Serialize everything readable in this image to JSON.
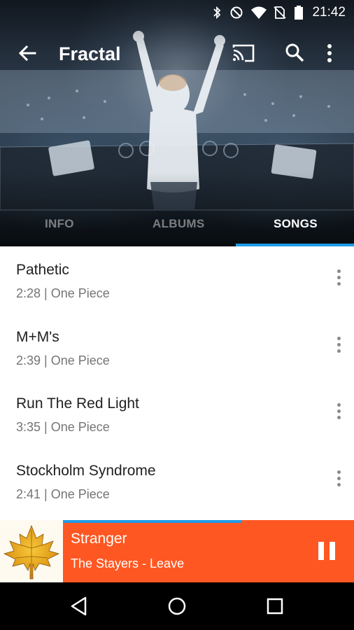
{
  "status_bar": {
    "time": "21:42",
    "icons": [
      "bluetooth-icon",
      "do-not-disturb-icon",
      "wifi-icon",
      "no-sim-icon",
      "battery-icon"
    ]
  },
  "toolbar": {
    "title": "Fractal",
    "icons": [
      "back-arrow-icon",
      "cast-icon",
      "search-icon",
      "more-vert-icon"
    ]
  },
  "tabs": [
    {
      "label": "INFO",
      "selected": false
    },
    {
      "label": "ALBUMS",
      "selected": false
    },
    {
      "label": "SONGS",
      "selected": true
    }
  ],
  "songs": [
    {
      "title": "Pathetic",
      "subtitle": "2:28 | One Piece"
    },
    {
      "title": "M+M's",
      "subtitle": "2:39 | One Piece"
    },
    {
      "title": "Run The Red Light",
      "subtitle": "3:35 | One Piece"
    },
    {
      "title": "Stockholm Syndrome",
      "subtitle": "2:41 | One Piece"
    }
  ],
  "now_playing": {
    "title": "Stranger",
    "subtitle": "The Stayers - Leave",
    "progress_fraction": 0.615,
    "state": "playing"
  },
  "colors": {
    "accent": "#1e9be6",
    "player_bg": "#ff5722",
    "nav_bg": "#000000"
  },
  "nav_bar": {
    "icons": [
      "back-triangle-icon",
      "home-circle-icon",
      "recents-square-icon"
    ]
  }
}
